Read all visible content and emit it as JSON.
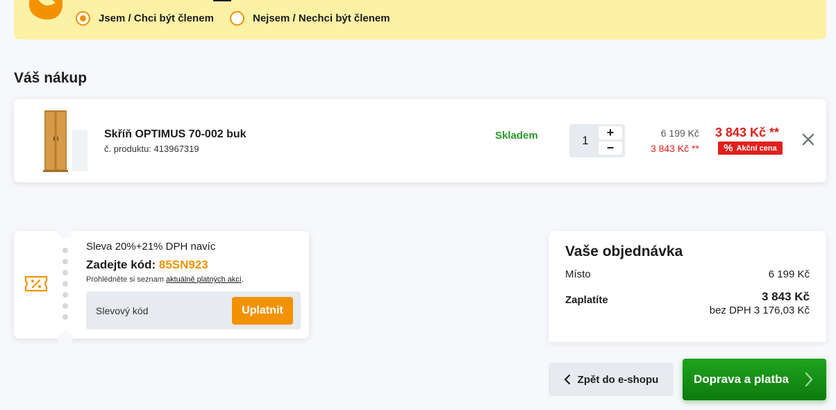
{
  "membership": {
    "option_yes": "Jsem / Chci být členem",
    "option_no": "Nejsem / Nechci být členem",
    "selected": "yes"
  },
  "cart": {
    "title": "Váš nákup",
    "item": {
      "name": "Skříň OPTIMUS 70-002 buk",
      "code": "č. produktu: 413967319",
      "stock": "Skladem",
      "quantity": "1",
      "qty_plus": "+",
      "qty_minus": "−",
      "price_original": "6 199 Kč",
      "price_member": "3 843 Kč **",
      "price_final": "3 843 Kč **",
      "badge_icon": "%",
      "badge": "Akční cena"
    }
  },
  "coupon": {
    "title": "Sleva 20%+21% DPH navíc",
    "code_prefix": "Zadejte kód:",
    "code": "85SN923",
    "note_prefix": "Prohlédněte si seznam",
    "note_link": "aktuálně platných akcí",
    "note_suffix": ".",
    "input_placeholder": "Slevový kód",
    "apply_label": "Uplatnit"
  },
  "summary": {
    "title": "Vaše objednávka",
    "place_label": "Místo",
    "place_value": "6 199 Kč",
    "pay_label": "Zaplatíte",
    "pay_value": "3 843 Kč",
    "pay_without_vat": "bez DPH 3 176,03 Kč"
  },
  "actions": {
    "back_label": "Zpět do e-shopu",
    "next_label": "Doprava a platba"
  },
  "colors": {
    "accent_orange": "#f39200",
    "sale_red": "#e0201b",
    "stock_green": "#2c9a2c",
    "banner_yellow": "#fdf1a6"
  }
}
